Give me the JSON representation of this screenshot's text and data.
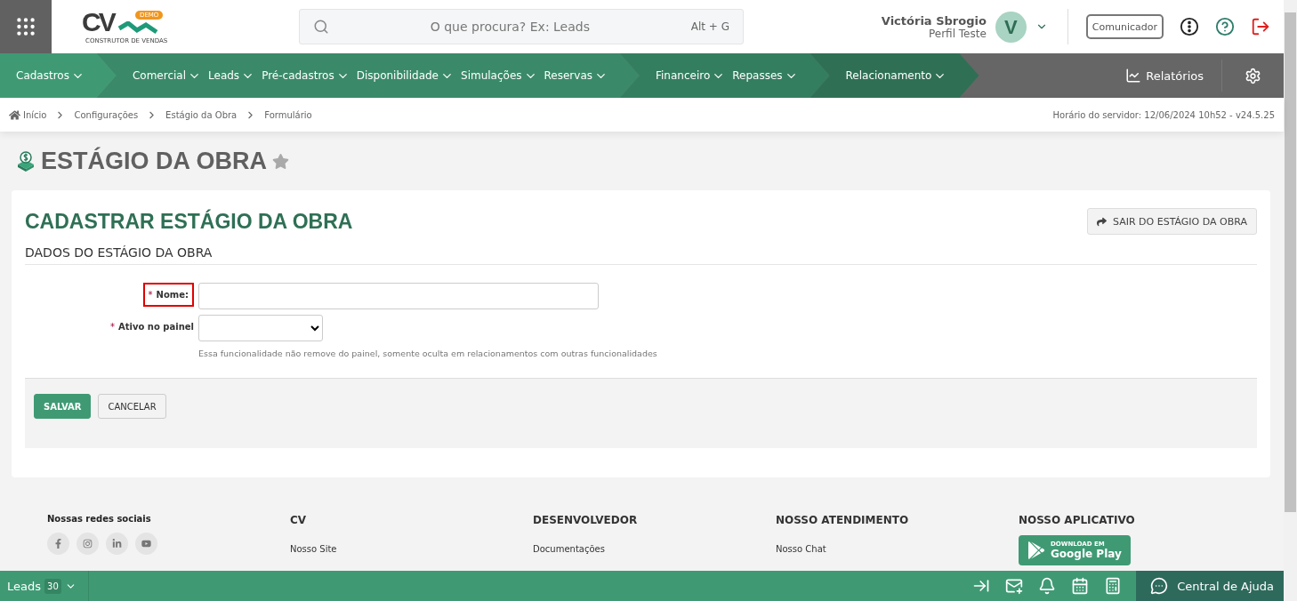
{
  "header": {
    "logo": {
      "mark": "CV",
      "badge": "DEMO",
      "tagline": "CONSTRUTOR DE VENDAS"
    },
    "search": {
      "placeholder": "O que procura? Ex: Leads",
      "shortcut": "Alt + G"
    },
    "user": {
      "name": "Victória Sbrogio",
      "profile": "Perfil Teste",
      "initial": "V"
    },
    "communicator": "Comunicador"
  },
  "nav": {
    "sections": [
      {
        "color": "#3f9a74",
        "items": [
          {
            "label": "Cadastros"
          }
        ]
      },
      {
        "color": "#3a8a69",
        "items": [
          {
            "label": "Comercial"
          },
          {
            "label": "Leads"
          },
          {
            "label": "Pré-cadastros"
          },
          {
            "label": "Disponibilidade"
          },
          {
            "label": "Simulações"
          },
          {
            "label": "Reservas"
          }
        ]
      },
      {
        "color": "#347e60",
        "items": [
          {
            "label": "Financeiro"
          },
          {
            "label": "Repasses"
          }
        ]
      },
      {
        "color": "#2f7055",
        "items": [
          {
            "label": "Relacionamento"
          }
        ]
      }
    ],
    "reports": "Relatórios"
  },
  "breadcrumb": [
    {
      "label": "Início",
      "home": true
    },
    {
      "label": "Configurações",
      "home": false
    },
    {
      "label": "Estágio da Obra",
      "home": false
    },
    {
      "label": "Formulário",
      "home": false
    }
  ],
  "server_time": "Horário do servidor: 12/06/2024 10h52 - v24.5.25",
  "page_title": "ESTÁGIO DA OBRA",
  "favorite": false,
  "card": {
    "title": "CADASTRAR ESTÁGIO DA OBRA",
    "exit_button": "SAIR DO ESTÁGIO DA OBRA",
    "section_title": "DADOS DO ESTÁGIO DA OBRA",
    "fields": [
      {
        "kind": "text",
        "required_mark": "*",
        "label": "Nome:",
        "highlighted": true
      },
      {
        "kind": "select",
        "required_mark": "*",
        "label": "Ativo no painel",
        "highlighted": false,
        "help": "Essa funcionalidade não remove do painel, somente oculta em relacionamentos com outras funcionalidades"
      }
    ],
    "buttons": [
      {
        "label": "SALVAR",
        "primary": true
      },
      {
        "label": "CANCELAR",
        "primary": false
      }
    ]
  },
  "footer": {
    "social_title": "Nossas redes sociais",
    "columns": [
      {
        "title": "CV",
        "links": [
          "Nosso Site"
        ]
      },
      {
        "title": "DESENVOLVEDOR",
        "links": [
          "Documentações"
        ]
      },
      {
        "title": "NOSSO ATENDIMENTO",
        "links": [
          "Nosso Chat"
        ]
      },
      {
        "title": "NOSSO APLICATIVO",
        "store": {
          "small": "DOWNLOAD EM",
          "big": "Google Play"
        }
      }
    ]
  },
  "bottom_bar": {
    "label": "Leads",
    "count": "30",
    "help": "Central de Ajuda"
  }
}
